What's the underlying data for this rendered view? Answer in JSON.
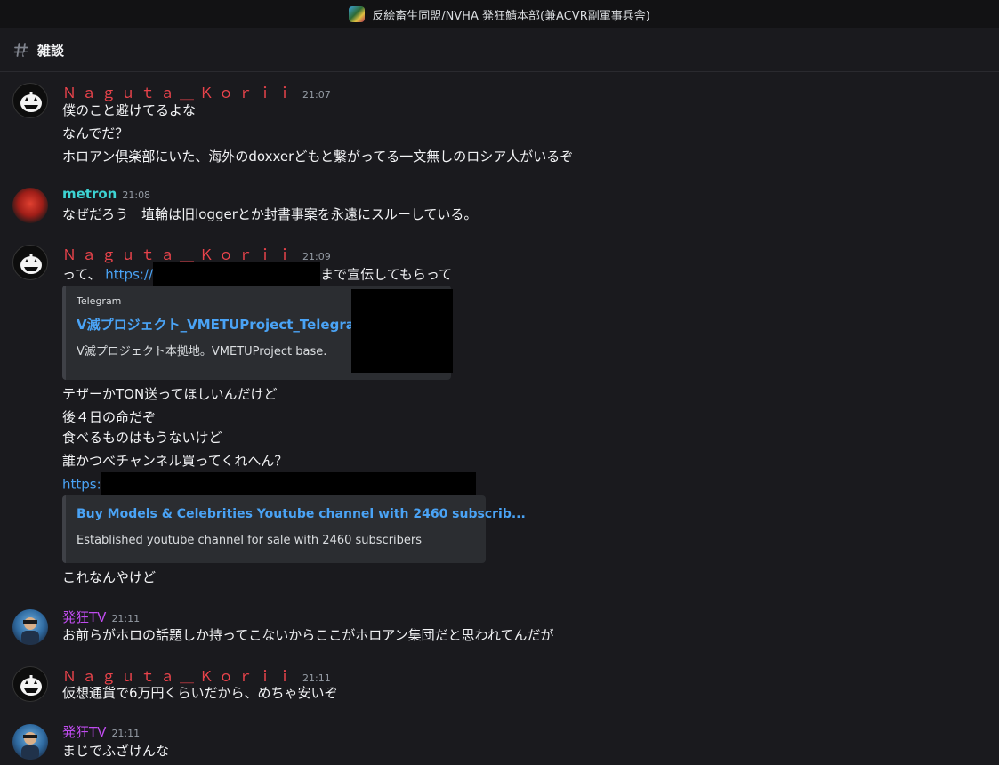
{
  "window": {
    "title": "反絵畜生同盟/NVHA 発狂鯖本部(兼ACVR副軍事兵舎)"
  },
  "channel": {
    "name": "雑談"
  },
  "messages": [
    {
      "author": "Ｎａｇｕｔａ＿Ｋｏｒｉｉ",
      "time": "21:07",
      "lines": [
        "僕のこと避けてるよな",
        "なんでだ？",
        "ホロアン倶楽部にいた、海外のdoxxerどもと繋がってる一文無しのロシア人がいるぞ"
      ]
    },
    {
      "author": "metron",
      "time": "21:08",
      "lines": [
        "なぜだろう　埴輪は旧loggerとか封書事案を永遠にスルーしている。"
      ]
    },
    {
      "author": "Ｎａｇｕｔａ＿Ｋｏｒｉｉ",
      "time": "21:09",
      "first_prefix": "って、 ",
      "first_link": "https://",
      "first_suffix": "まで宣伝してもらって",
      "embed1": {
        "provider": "Telegram",
        "title": "V滅プロジェクト_VMETUProject_Telegram",
        "description": "V滅プロジェクト本拠地。VMETUProject base."
      },
      "lines": [
        "テザーかTON送ってほしいんだけど",
        "後４日の命だぞ",
        "食べるものはもうないけど",
        "誰かつべチャンネル買ってくれへん？"
      ],
      "link2": "https:",
      "embed2": {
        "title": "Buy Models & Celebrities Youtube channel with 2460 subscrib...",
        "description": "Established youtube channel for sale with 2460 subscribers"
      },
      "last_line": "これなんやけど"
    },
    {
      "author": "発狂TV",
      "time": "21:11",
      "lines": [
        "お前らがホロの話題しか持ってこないからここがホロアン集団だと思われてんだが"
      ]
    },
    {
      "author": "Ｎａｇｕｔａ＿Ｋｏｒｉｉ",
      "time": "21:11",
      "lines": [
        "仮想通貨で6万円くらいだから、めちゃ安いぞ"
      ]
    },
    {
      "author": "発狂TV",
      "time": "21:11",
      "lines": [
        "まじでふざけんな"
      ]
    }
  ],
  "icons": {
    "channel": "hash-icon",
    "server": "server-icon"
  }
}
